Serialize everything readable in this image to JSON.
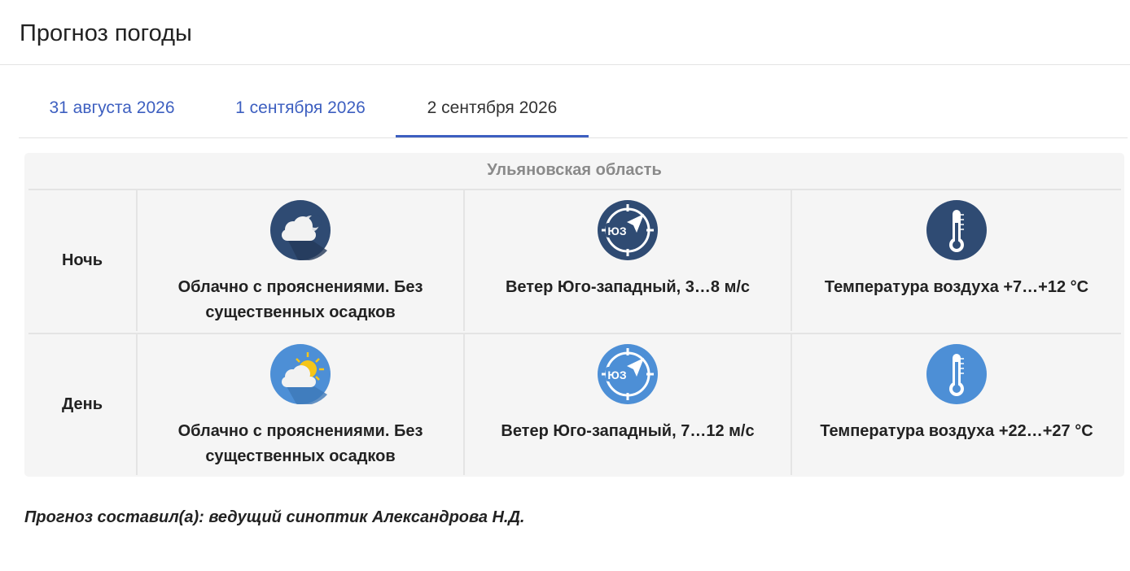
{
  "header": {
    "title": "Прогноз погоды"
  },
  "tabs": [
    {
      "label": "31 августа 2026",
      "active": false
    },
    {
      "label": "1 сентября 2026",
      "active": false
    },
    {
      "label": "2 сентября 2026",
      "active": true
    }
  ],
  "forecast": {
    "region": "Ульяновская область",
    "rows": [
      {
        "period": "Ночь",
        "icon_theme": "dark-blue",
        "sky": {
          "icon": "cloud-moon-icon",
          "text": "Облачно с прояснениями. Без существенных осадков"
        },
        "wind": {
          "icon": "compass-icon",
          "direction_abbr": "ЮЗ",
          "text": "Ветер Юго-западный, 3…8 м/с"
        },
        "temperature": {
          "icon": "thermometer-icon",
          "text": "Температура воздуха +7…+12 °C"
        }
      },
      {
        "period": "День",
        "icon_theme": "light-blue",
        "sky": {
          "icon": "cloud-sun-icon",
          "text": "Облачно с прояснениями. Без существенных осадков"
        },
        "wind": {
          "icon": "compass-icon",
          "direction_abbr": "ЮЗ",
          "text": "Ветер Юго-западный, 7…12 м/с"
        },
        "temperature": {
          "icon": "thermometer-icon",
          "text": "Температура воздуха +22…+27 °C"
        }
      }
    ]
  },
  "footer": {
    "author": "Прогноз составил(а): ведущий синоптик Александрова Н.Д."
  },
  "colors": {
    "accent": "#3d5fc0",
    "night_icon": "#2f4b73",
    "day_icon": "#4d8fd6",
    "panel_bg": "#f5f5f5",
    "region_text": "#8a8a8a"
  }
}
